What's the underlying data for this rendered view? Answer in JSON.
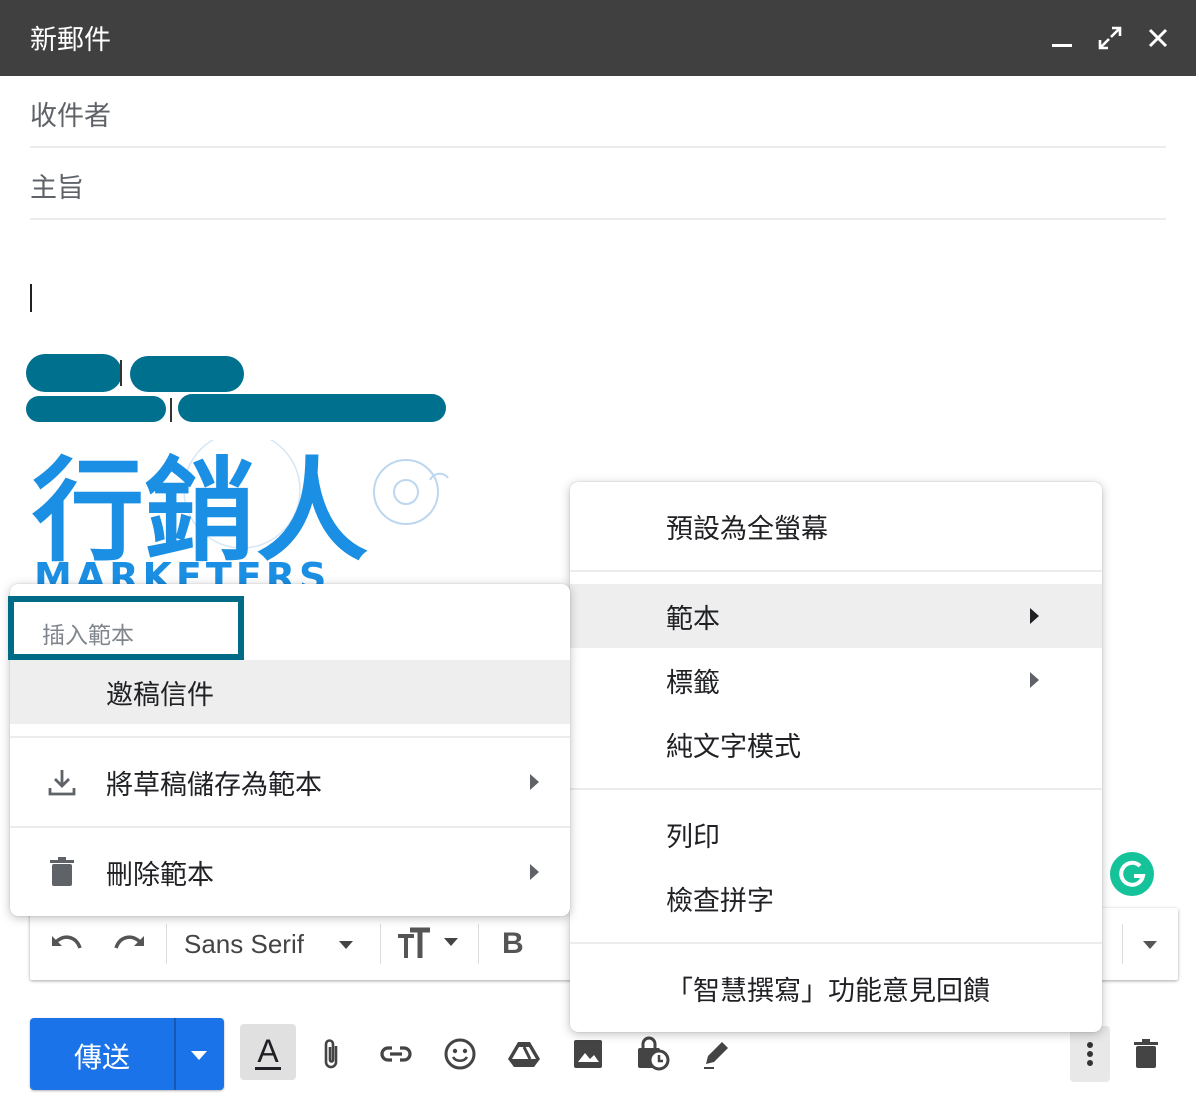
{
  "window": {
    "title": "新郵件",
    "controls": [
      "minimize-icon",
      "expand-icon",
      "close-icon"
    ]
  },
  "fields": {
    "to_placeholder": "收件者",
    "subject_placeholder": "主旨"
  },
  "signature": {
    "logo_text": "行銷人",
    "logo_subtext": "MARKETERS",
    "logo_color": "#1a8fe3",
    "redaction_color": "#00708f"
  },
  "format_toolbar": {
    "font": "Sans Serif",
    "bold_label": "B"
  },
  "bottom_bar": {
    "send_label": "傳送",
    "send_color": "#1a73e8",
    "text_format_label": "A"
  },
  "template_menu": {
    "search_placeholder": "插入範本",
    "items": [
      {
        "label": "邀稿信件"
      },
      {
        "label": "將草稿儲存為範本",
        "icon": "download-icon"
      },
      {
        "label": "刪除範本",
        "icon": "trash-icon"
      }
    ]
  },
  "more_menu": {
    "items": [
      {
        "label": "預設為全螢幕"
      },
      {
        "label": "範本"
      },
      {
        "label": "標籤"
      },
      {
        "label": "純文字模式"
      },
      {
        "label": "列印"
      },
      {
        "label": "檢查拼字"
      },
      {
        "label": "「智慧撰寫」功能意見回饋"
      }
    ]
  }
}
